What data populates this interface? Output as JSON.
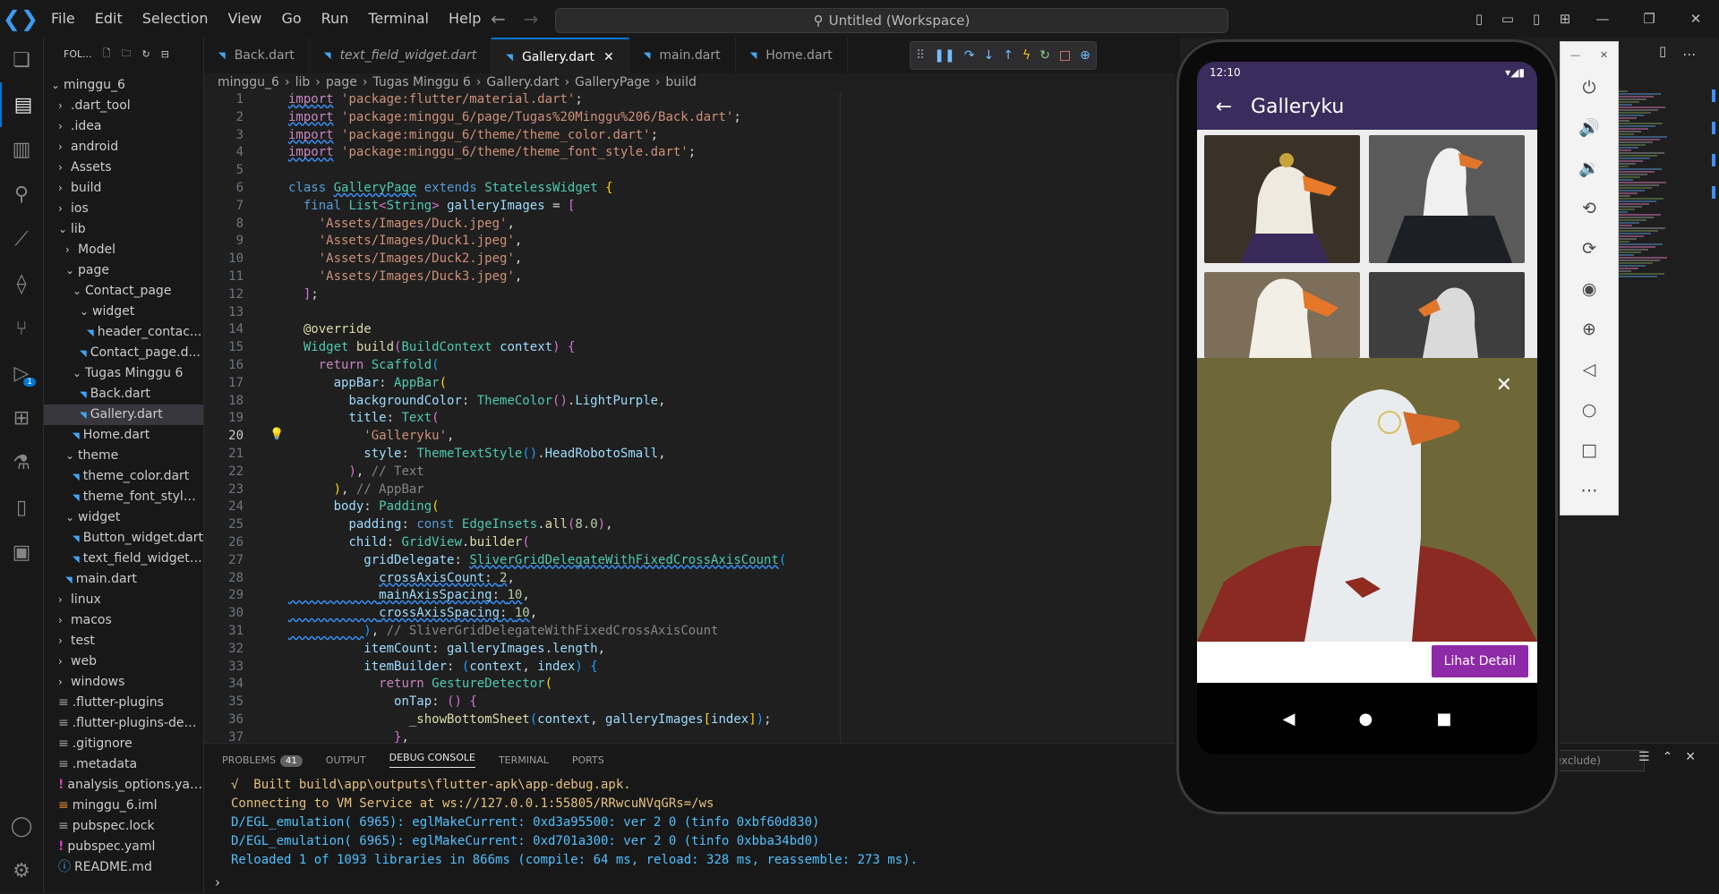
{
  "window": {
    "search_text": "Untitled (Workspace)",
    "menu": [
      "File",
      "Edit",
      "Selection",
      "View",
      "Go",
      "Run",
      "Terminal",
      "Help"
    ]
  },
  "activity_badge": "1",
  "sidebar": {
    "header": "FOL...",
    "tree": [
      {
        "label": "minggu_6",
        "indent": 0,
        "type": "open"
      },
      {
        "label": ".dart_tool",
        "indent": 1,
        "type": "closed"
      },
      {
        "label": ".idea",
        "indent": 1,
        "type": "closed"
      },
      {
        "label": "android",
        "indent": 1,
        "type": "closed"
      },
      {
        "label": "Assets",
        "indent": 1,
        "type": "closed"
      },
      {
        "label": "build",
        "indent": 1,
        "type": "closed"
      },
      {
        "label": "ios",
        "indent": 1,
        "type": "closed"
      },
      {
        "label": "lib",
        "indent": 1,
        "type": "open"
      },
      {
        "label": "Model",
        "indent": 2,
        "type": "closed"
      },
      {
        "label": "page",
        "indent": 2,
        "type": "open"
      },
      {
        "label": "Contact_page",
        "indent": 3,
        "type": "open"
      },
      {
        "label": "widget",
        "indent": 4,
        "type": "open"
      },
      {
        "label": "header_contac...",
        "indent": 5,
        "type": "dart"
      },
      {
        "label": "Contact_page.d...",
        "indent": 4,
        "type": "dart"
      },
      {
        "label": "Tugas Minggu 6",
        "indent": 3,
        "type": "open"
      },
      {
        "label": "Back.dart",
        "indent": 4,
        "type": "dart"
      },
      {
        "label": "Gallery.dart",
        "indent": 4,
        "type": "dart",
        "selected": true
      },
      {
        "label": "Home.dart",
        "indent": 3,
        "type": "dart"
      },
      {
        "label": "theme",
        "indent": 2,
        "type": "open"
      },
      {
        "label": "theme_color.dart",
        "indent": 3,
        "type": "dart"
      },
      {
        "label": "theme_font_style....",
        "indent": 3,
        "type": "dart"
      },
      {
        "label": "widget",
        "indent": 2,
        "type": "open"
      },
      {
        "label": "Button_widget.dart",
        "indent": 3,
        "type": "dart"
      },
      {
        "label": "text_field_widget....",
        "indent": 3,
        "type": "dart"
      },
      {
        "label": "main.dart",
        "indent": 2,
        "type": "dart"
      },
      {
        "label": "linux",
        "indent": 1,
        "type": "closed"
      },
      {
        "label": "macos",
        "indent": 1,
        "type": "closed"
      },
      {
        "label": "test",
        "indent": 1,
        "type": "closed"
      },
      {
        "label": "web",
        "indent": 1,
        "type": "closed"
      },
      {
        "label": "windows",
        "indent": 1,
        "type": "closed"
      },
      {
        "label": ".flutter-plugins",
        "indent": 1,
        "type": "misc"
      },
      {
        "label": ".flutter-plugins-dep...",
        "indent": 1,
        "type": "misc"
      },
      {
        "label": ".gitignore",
        "indent": 1,
        "type": "misc"
      },
      {
        "label": ".metadata",
        "indent": 1,
        "type": "misc"
      },
      {
        "label": "analysis_options.yaml",
        "indent": 1,
        "type": "yaml"
      },
      {
        "label": "minggu_6.iml",
        "indent": 1,
        "type": "xml"
      },
      {
        "label": "pubspec.lock",
        "indent": 1,
        "type": "misc"
      },
      {
        "label": "pubspec.yaml",
        "indent": 1,
        "type": "yaml"
      },
      {
        "label": "README.md",
        "indent": 1,
        "type": "info"
      }
    ]
  },
  "tabs": [
    {
      "label": "Back.dart",
      "active": false,
      "italic": false
    },
    {
      "label": "text_field_widget.dart",
      "active": false,
      "italic": true
    },
    {
      "label": "Gallery.dart",
      "active": true,
      "italic": false
    },
    {
      "label": "main.dart",
      "active": false,
      "italic": false
    },
    {
      "label": "Home.dart",
      "active": false,
      "italic": false
    }
  ],
  "breadcrumb": [
    "minggu_6",
    "lib",
    "page",
    "Tugas Minggu 6",
    "Gallery.dart",
    "GalleryPage",
    "build"
  ],
  "editor": {
    "current_line": 20,
    "lines": [
      {
        "n": 1,
        "html": "<span class='ctl sq'>import</span> <span class='str'>'package:flutter/material.dart'</span>;"
      },
      {
        "n": 2,
        "html": "<span class='ctl sq'>import</span> <span class='str'>'package:minggu_6/page/Tugas%20Minggu%206/Back.dart'</span>;"
      },
      {
        "n": 3,
        "html": "<span class='ctl sq'>import</span> <span class='str'>'package:minggu_6/theme/theme_color.dart'</span>;"
      },
      {
        "n": 4,
        "html": "<span class='ctl sq'>import</span> <span class='str'>'package:minggu_6/theme/theme_font_style.dart'</span>;"
      },
      {
        "n": 5,
        "html": ""
      },
      {
        "n": 6,
        "html": "<span class='kw'>class</span> <span class='cls sq'>GalleryPage</span> <span class='kw'>extends</span> <span class='cls'>StatelessWidget</span> <span class='pb'>{</span>"
      },
      {
        "n": 7,
        "html": "  <span class='kw'>final</span> <span class='cls'>List</span><span class='pp'>&lt;</span><span class='cls'>String</span><span class='pp'>&gt;</span> <span class='var'>galleryImages</span> = <span class='pp'>[</span>"
      },
      {
        "n": 8,
        "html": "    <span class='str'>'Assets/Images/Duck.jpeg'</span>,"
      },
      {
        "n": 9,
        "html": "    <span class='str'>'Assets/Images/Duck1.jpeg'</span>,"
      },
      {
        "n": 10,
        "html": "    <span class='str'>'Assets/Images/Duck2.jpeg'</span>,"
      },
      {
        "n": 11,
        "html": "    <span class='str'>'Assets/Images/Duck3.jpeg'</span>,"
      },
      {
        "n": 12,
        "html": "  <span class='pp'>]</span>;"
      },
      {
        "n": 13,
        "html": ""
      },
      {
        "n": 14,
        "html": "  <span class='ann'>@override</span>"
      },
      {
        "n": 15,
        "html": "  <span class='cls'>Widget</span> <span class='fn'>build</span><span class='pp'>(</span><span class='cls'>BuildContext</span> <span class='var'>context</span><span class='pp'>)</span> <span class='pp'>{</span>"
      },
      {
        "n": 16,
        "html": "    <span class='ctl'>return</span> <span class='cls'>Scaffold</span><span class='pbl'>(</span>"
      },
      {
        "n": 17,
        "html": "      <span class='var'>appBar</span>: <span class='cls'>AppBar</span><span class='pb'>(</span>"
      },
      {
        "n": 18,
        "html": "        <span class='var'>backgroundColor</span>: <span class='cls'>ThemeColor</span><span class='pp'>()</span>.<span class='var'>LightPurple</span>,"
      },
      {
        "n": 19,
        "html": "        <span class='var'>title</span>: <span class='cls'>Text</span><span class='pp'>(</span>"
      },
      {
        "n": 20,
        "html": "          <span class='str'>'Galleryku'</span>,"
      },
      {
        "n": 21,
        "html": "          <span class='var'>style</span>: <span class='cls'>ThemeTextStyle</span><span class='pbl'>()</span>.<span class='var'>HeadRobotoSmall</span>,"
      },
      {
        "n": 22,
        "html": "        <span class='pp'>)</span>, <span class='cm'>// Text</span>"
      },
      {
        "n": 23,
        "html": "      <span class='pb'>)</span>, <span class='cm'>// AppBar</span>"
      },
      {
        "n": 24,
        "html": "      <span class='var'>body</span>: <span class='cls'>Padding</span><span class='pb'>(</span>"
      },
      {
        "n": 25,
        "html": "        <span class='var'>padding</span>: <span class='kw'>const</span> <span class='cls'>EdgeInsets</span>.<span class='fn'>all</span><span class='pp'>(</span><span class='num'>8.0</span><span class='pp'>)</span>,"
      },
      {
        "n": 26,
        "html": "        <span class='var'>child</span>: <span class='cls'>GridView</span>.<span class='fn'>builder</span><span class='pp'>(</span>"
      },
      {
        "n": 27,
        "html": "          <span class='var'>gridDelegate</span>: <span class='cls sq'>SliverGridDelegateWithFixedCrossAxisCount</span><span class='pbl'>(</span>"
      },
      {
        "n": 28,
        "html": "            <span class='var sq'>crossAxisCount</span><span class='sq'>: </span><span class='num sq'>2</span>,"
      },
      {
        "n": 29,
        "html": "<span class='sq'>            </span><span class='var sq'>mainAxisSpacing</span><span class='sq'>: </span><span class='num sq'>10</span>,"
      },
      {
        "n": 30,
        "html": "<span class='sq'>            </span><span class='var sq'>crossAxisSpacing</span><span class='sq'>: </span><span class='num sq'>10</span>,"
      },
      {
        "n": 31,
        "html": "<span class='sq'>          </span><span class='pbl'>)</span>, <span class='cm'>// SliverGridDelegateWithFixedCrossAxisCount</span>"
      },
      {
        "n": 32,
        "html": "          <span class='var'>itemCount</span>: <span class='var'>galleryImages</span>.<span class='var'>length</span>,"
      },
      {
        "n": 33,
        "html": "          <span class='var'>itemBuilder</span>: <span class='pbl'>(</span><span class='var'>context</span>, <span class='var'>index</span><span class='pbl'>)</span> <span class='pbl'>{</span>"
      },
      {
        "n": 34,
        "html": "            <span class='ctl'>return</span> <span class='cls'>GestureDetector</span><span class='pb'>(</span>"
      },
      {
        "n": 35,
        "html": "              <span class='var'>onTap</span>: <span class='pp'>()</span> <span class='pp'>{</span>"
      },
      {
        "n": 36,
        "html": "                <span class='fn'>_showBottomSheet</span><span class='pbl'>(</span><span class='var'>context</span>, <span class='var'>galleryImages</span><span class='pb'>[</span><span class='var'>index</span><span class='pb'>]</span><span class='pbl'>)</span>;"
      },
      {
        "n": 37,
        "html": "              <span class='pp'>}</span>,"
      }
    ]
  },
  "panel": {
    "tabs": [
      "PROBLEMS",
      "OUTPUT",
      "DEBUG CONSOLE",
      "TERMINAL",
      "PORTS"
    ],
    "active_tab": "DEBUG CONSOLE",
    "problems_count": "41",
    "filter_placeholder": "(exclude)",
    "console": [
      {
        "text": "√  Built build\\app\\outputs\\flutter-apk\\app-debug.apk.",
        "cls": "c-yel"
      },
      {
        "text": "Connecting to VM Service at ws://127.0.0.1:55805/RRwcuNVqGRs=/ws",
        "cls": "c-yel"
      },
      {
        "text": "D/EGL_emulation( 6965): eglMakeCurrent: 0xd3a95500: ver 2 0 (tinfo 0xbf60d830)",
        "cls": "c-blue"
      },
      {
        "text": "D/EGL_emulation( 6965): eglMakeCurrent: 0xd701a300: ver 2 0 (tinfo 0xbba34bd0)",
        "cls": "c-blue"
      },
      {
        "text": "Reloaded 1 of 1093 libraries in 866ms (compile: 64 ms, reload: 328 ms, reassemble: 273 ms).",
        "cls": "c-blue"
      }
    ]
  },
  "phone": {
    "time": "12:10",
    "app_title": "Galleryku",
    "detail_button": "Lihat Detail"
  },
  "colors": {
    "accent": "#0078d4",
    "appbar": "#3a2c5c",
    "detail_button": "#8e2aa8"
  }
}
